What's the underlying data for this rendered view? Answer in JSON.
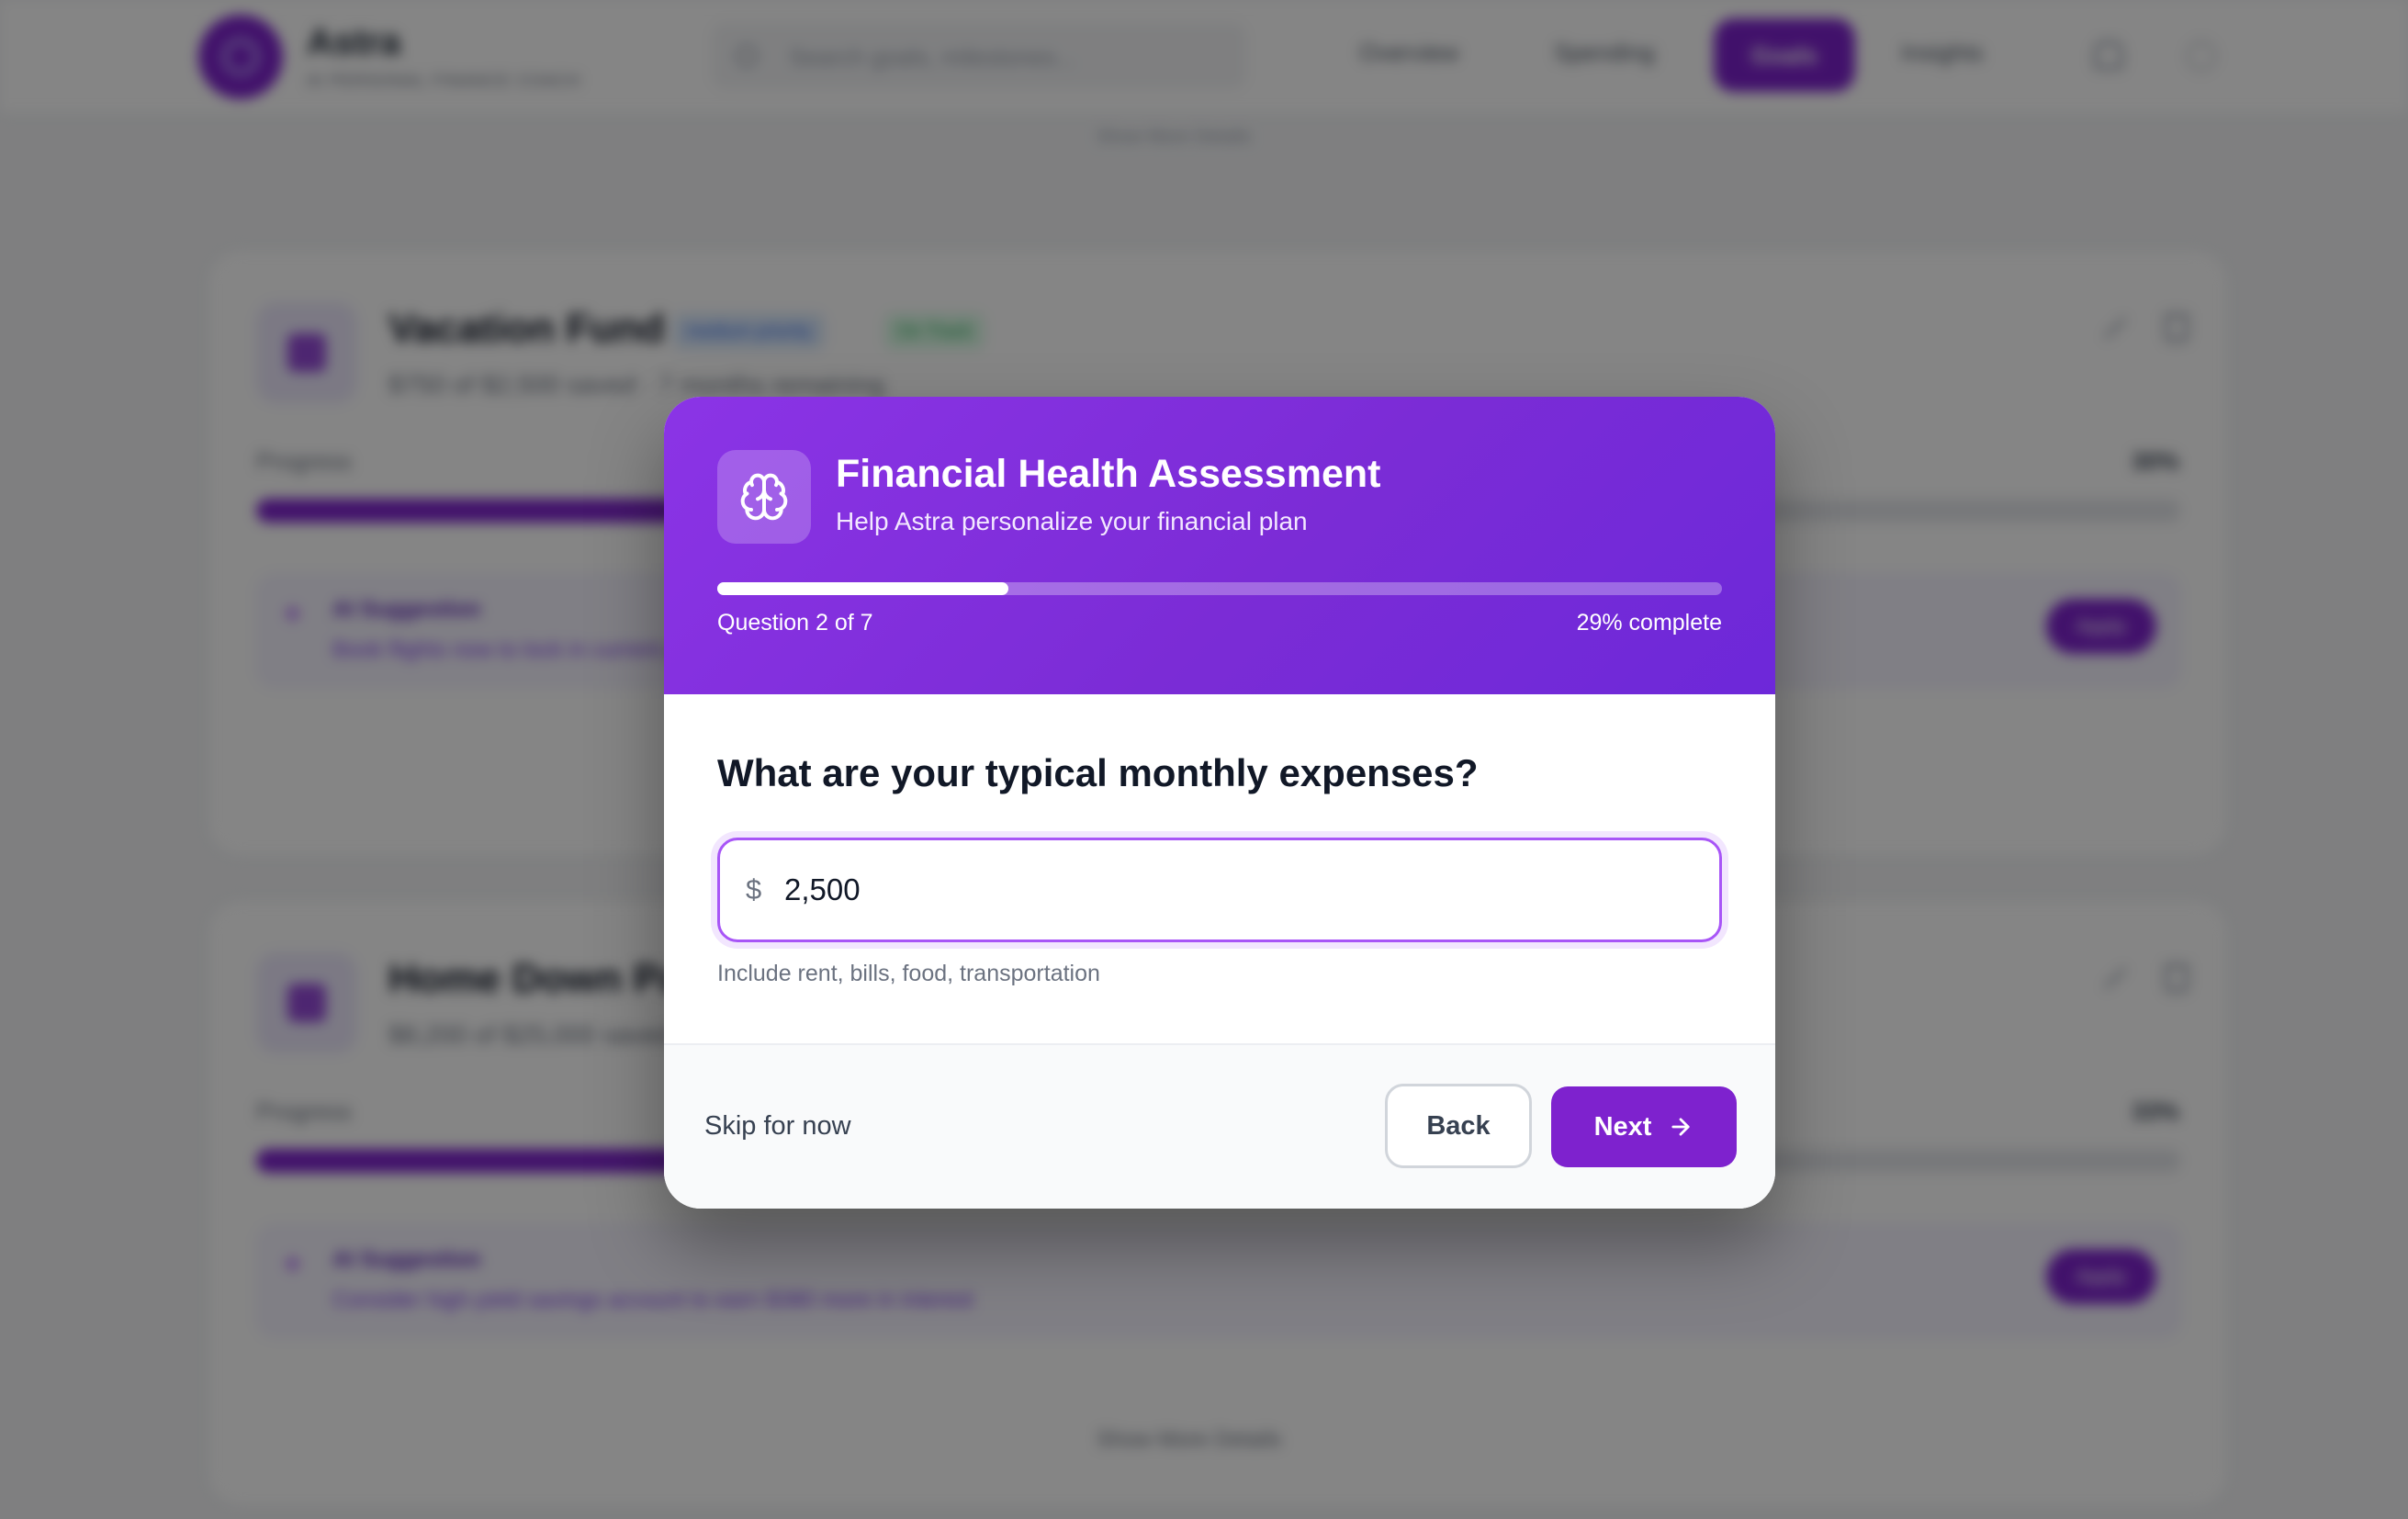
{
  "app": {
    "brand_name": "Astra",
    "brand_tagline": "AI PERSONAL FINANCE COACH",
    "search_placeholder": "Search goals, milestones...",
    "nav": [
      "Overview",
      "Spending",
      "Goals",
      "Insights"
    ],
    "active_nav": "Goals",
    "show_more": "Show More Details"
  },
  "goals": [
    {
      "title": "Vacation Fund",
      "badge_priority": "medium priority",
      "badge_status": "On Track",
      "summary": "$750 of $2,500 saved · 7 months remaining",
      "progress_label": "Progress",
      "progress_pct_text": "30%",
      "progress": 0.3,
      "ai_title": "AI Suggestion",
      "ai_text": "Book flights now to lock in current prices",
      "ai_action": "Apply"
    },
    {
      "title": "Home Down Payment",
      "summary": "$8,200 of $25,000 saved",
      "progress_label": "Progress",
      "progress_pct_text": "33%",
      "progress": 0.33,
      "ai_title": "AI Suggestion",
      "ai_text": "Consider high-yield savings account to earn $380 more in interest",
      "ai_action": "Apply"
    }
  ],
  "modal": {
    "title": "Financial Health Assessment",
    "subtitle": "Help Astra personalize your financial plan",
    "question_counter": "Question 2 of 7",
    "complete_text": "29% complete",
    "progress": 0.29,
    "question": "What are your typical monthly expenses?",
    "currency_symbol": "$",
    "input_value": "2,500",
    "hint": "Include rent, bills, food, transportation",
    "skip_label": "Skip for now",
    "back_label": "Back",
    "next_label": "Next"
  },
  "icons": {
    "header_icon": "brain-icon",
    "next_icon": "arrow-right-icon"
  },
  "colors": {
    "accent": "#7e22ce",
    "header_gradient_start": "#8b34e6",
    "header_gradient_end": "#6d28d9",
    "input_focus": "#a855f7"
  }
}
